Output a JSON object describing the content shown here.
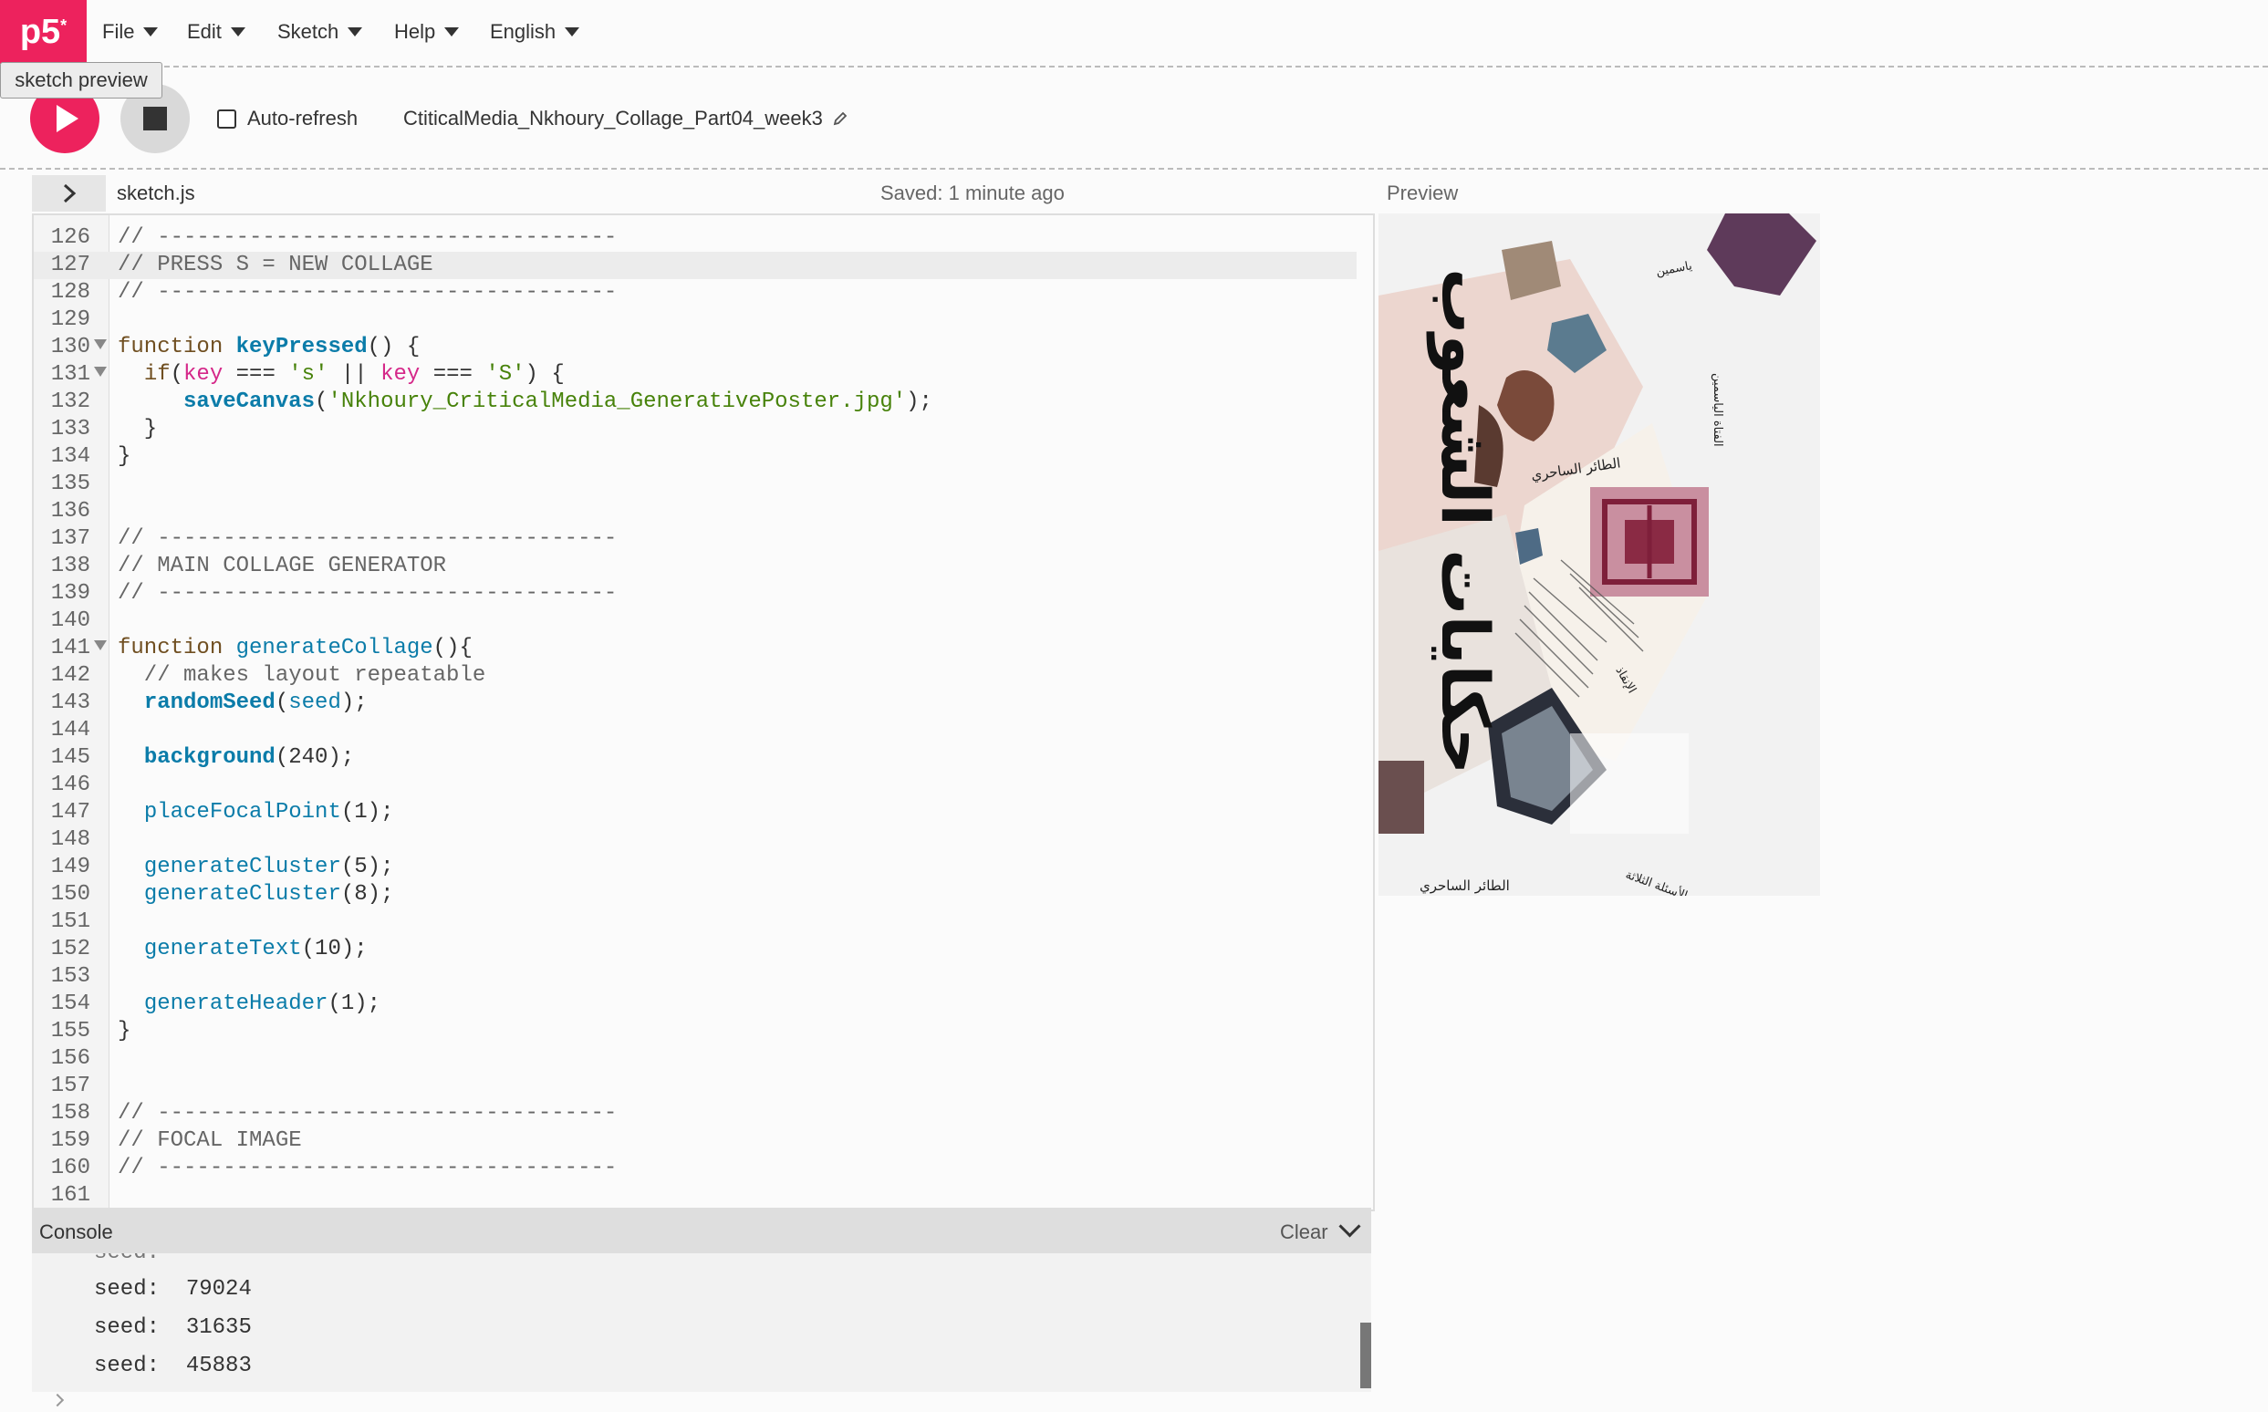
{
  "app": {
    "logo": "p5",
    "logo_mark": "*"
  },
  "menu": [
    {
      "label": "File"
    },
    {
      "label": "Edit"
    },
    {
      "label": "Sketch"
    },
    {
      "label": "Help"
    },
    {
      "label": "English"
    }
  ],
  "tooltip": "sketch preview",
  "toolbar": {
    "auto_refresh_label": "Auto-refresh",
    "auto_refresh_checked": false,
    "sketch_name": "CtiticalMedia_Nkhoury_Collage_Part04_week3"
  },
  "editor": {
    "file_name": "sketch.js",
    "save_status": "Saved: 1 minute ago",
    "current_line": 127,
    "lines": [
      {
        "n": "126",
        "text": "// -----------------------------------"
      },
      {
        "n": "127",
        "text": "// PRESS S = NEW COLLAGE"
      },
      {
        "n": "128",
        "text": "// -----------------------------------"
      },
      {
        "n": "129",
        "text": ""
      },
      {
        "n": "130",
        "text": "function keyPressed() {"
      },
      {
        "n": "131",
        "text": "  if(key === 's' || key === 'S') {"
      },
      {
        "n": "132",
        "text": "     saveCanvas('Nkhoury_CriticalMedia_GenerativePoster.jpg');"
      },
      {
        "n": "133",
        "text": "  }"
      },
      {
        "n": "134",
        "text": "}"
      },
      {
        "n": "135",
        "text": ""
      },
      {
        "n": "136",
        "text": ""
      },
      {
        "n": "137",
        "text": "// -----------------------------------"
      },
      {
        "n": "138",
        "text": "// MAIN COLLAGE GENERATOR"
      },
      {
        "n": "139",
        "text": "// -----------------------------------"
      },
      {
        "n": "140",
        "text": ""
      },
      {
        "n": "141",
        "text": "function generateCollage(){"
      },
      {
        "n": "142",
        "text": "  // makes layout repeatable"
      },
      {
        "n": "143",
        "text": "  randomSeed(seed);"
      },
      {
        "n": "144",
        "text": ""
      },
      {
        "n": "145",
        "text": "  background(240);"
      },
      {
        "n": "146",
        "text": ""
      },
      {
        "n": "147",
        "text": "  placeFocalPoint(1);"
      },
      {
        "n": "148",
        "text": ""
      },
      {
        "n": "149",
        "text": "  generateCluster(5);"
      },
      {
        "n": "150",
        "text": "  generateCluster(8);"
      },
      {
        "n": "151",
        "text": ""
      },
      {
        "n": "152",
        "text": "  generateText(10);"
      },
      {
        "n": "153",
        "text": ""
      },
      {
        "n": "154",
        "text": "  generateHeader(1);"
      },
      {
        "n": "155",
        "text": "}"
      },
      {
        "n": "156",
        "text": ""
      },
      {
        "n": "157",
        "text": ""
      },
      {
        "n": "158",
        "text": "// -----------------------------------"
      },
      {
        "n": "159",
        "text": "// FOCAL IMAGE"
      },
      {
        "n": "160",
        "text": "// -----------------------------------"
      },
      {
        "n": "161",
        "text": ""
      }
    ]
  },
  "console": {
    "title": "Console",
    "clear_label": "Clear",
    "entries": [
      {
        "label": "seed:",
        "value": "79024"
      },
      {
        "label": "seed:",
        "value": "31635"
      },
      {
        "label": "seed:",
        "value": "45883"
      }
    ]
  },
  "preview": {
    "label": "Preview",
    "headline_text": "حكايات الشعوب",
    "labels": [
      {
        "text": "الطائر الساحري"
      },
      {
        "text": "الطائر الساحري"
      },
      {
        "text": "الأسئلة الثلاثة"
      },
      {
        "text": "الفتاة الياسمين"
      },
      {
        "text": "ياسمين"
      },
      {
        "text": "الإنقاذ"
      }
    ]
  },
  "colors": {
    "brand": "#ed225d",
    "comment": "#666666",
    "keyword": "#704f21",
    "function": "#0b7ca9",
    "variable": "#d52889",
    "string": "#47820a"
  },
  "icons": {
    "play": "play-icon",
    "stop": "stop-icon",
    "edit": "pencil-icon",
    "sidebar_toggle": "chevron-right-icon",
    "console_toggle": "chevron-down-icon"
  }
}
